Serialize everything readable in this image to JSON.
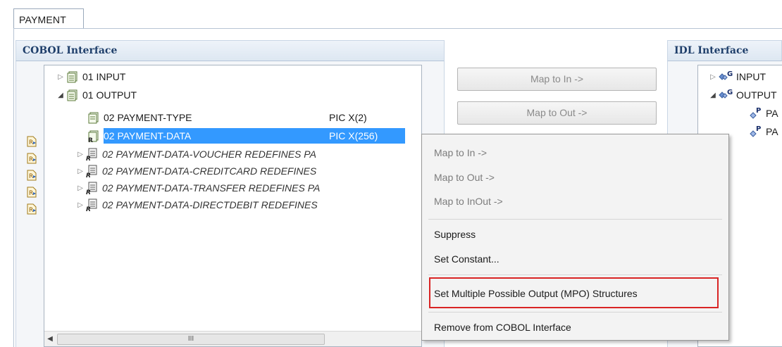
{
  "editor": {
    "tab_label": "PAYMENT"
  },
  "cobol_panel": {
    "title": "COBOL Interface",
    "rows": [
      {
        "label": "01 INPUT",
        "pic": "",
        "state": "collapsed",
        "icon": "group-icon"
      },
      {
        "label": "01 OUTPUT",
        "pic": "",
        "state": "expanded",
        "icon": "group-icon"
      },
      {
        "label": "02 PAYMENT-TYPE",
        "pic": "PIC X(2)",
        "state": "leaf",
        "icon": "field-icon"
      },
      {
        "label": "02 PAYMENT-DATA",
        "pic": "PIC X(256)",
        "state": "selected",
        "icon": "redefined-field-icon"
      },
      {
        "label": "02 PAYMENT-DATA-VOUCHER  REDEFINES PA",
        "pic": "",
        "state": "collapsed",
        "icon": "redefines-icon"
      },
      {
        "label": "02 PAYMENT-DATA-CREDITCARD REDEFINES",
        "pic": "",
        "state": "collapsed",
        "icon": "redefines-icon"
      },
      {
        "label": "02 PAYMENT-DATA-TRANSFER  REDEFINES PA",
        "pic": "",
        "state": "collapsed",
        "icon": "redefines-icon"
      },
      {
        "label": "02 PAYMENT-DATA-DIRECTDEBIT REDEFINES",
        "pic": "",
        "state": "collapsed",
        "icon": "redefines-icon"
      }
    ],
    "scrollbar_thumb_glyph": "III"
  },
  "mapping_buttons": {
    "map_to_in": "Map to In ->",
    "map_to_out": "Map to Out ->"
  },
  "idl_panel": {
    "title": "IDL Interface",
    "rows": [
      {
        "label": "INPUT",
        "badge": "G"
      },
      {
        "label": "OUTPUT",
        "badge": "G"
      },
      {
        "label": "PA",
        "badge": "P"
      },
      {
        "label": "PA",
        "badge": "P"
      }
    ]
  },
  "context_menu": {
    "items": [
      {
        "label": "Map to In ->",
        "enabled": false
      },
      {
        "label": "Map to Out ->",
        "enabled": false
      },
      {
        "label": "Map to InOut ->",
        "enabled": false
      },
      {
        "label": "Suppress",
        "enabled": true
      },
      {
        "label": "Set Constant...",
        "enabled": true
      },
      {
        "label": "Set Multiple Possible Output (MPO) Structures",
        "enabled": true,
        "highlighted": true
      },
      {
        "label": "Remove from COBOL Interface",
        "enabled": true
      }
    ]
  },
  "colors": {
    "selection": "#3399ff",
    "highlight_border": "#d92424",
    "panel_title": "#1f3f6b"
  }
}
